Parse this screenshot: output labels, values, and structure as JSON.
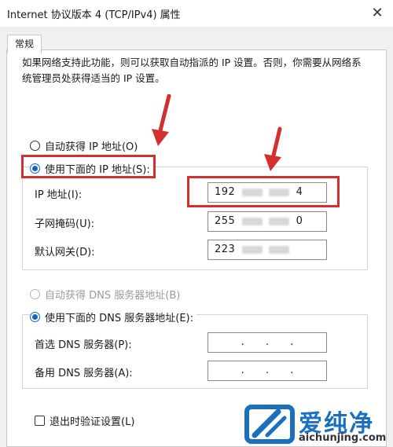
{
  "window": {
    "title": "Internet 协议版本 4 (TCP/IPv4) 属性",
    "close_glyph": "✕"
  },
  "tabs": [
    {
      "label": "常规"
    }
  ],
  "general": {
    "description": "如果网络支持此功能，则可以获取自动指派的 IP 设置。否则，你需要从网络系统管理员处获得适当的 IP 设置。",
    "ip_auto_label": "自动获得 IP 地址(O)",
    "ip_manual_label": "使用下面的 IP 地址(S):",
    "ip_mode": "manual",
    "fields": [
      {
        "label": "IP 地址(I):",
        "prefix": "192",
        "suffix": "4"
      },
      {
        "label": "子网掩码(U):",
        "prefix": "255",
        "suffix": "0"
      },
      {
        "label": "默认网关(D):",
        "prefix": "223",
        "suffix": ""
      }
    ],
    "dns_auto_label": "自动获得 DNS 服务器地址(B)",
    "dns_manual_label": "使用下面的 DNS 服务器地址(E):",
    "dns_mode": "manual",
    "dns_fields": [
      {
        "label": "首选 DNS 服务器(P):",
        "value": ". . ."
      },
      {
        "label": "备用 DNS 服务器(A):",
        "value": ". . ."
      }
    ],
    "validate_label": "退出时验证设置(L)",
    "validate_checked": false
  },
  "watermark": {
    "brand": "爱纯净",
    "domain": "aichunjing.com",
    "color": "#1a6fbf"
  },
  "annotations": {
    "color": "#d32f2f"
  }
}
